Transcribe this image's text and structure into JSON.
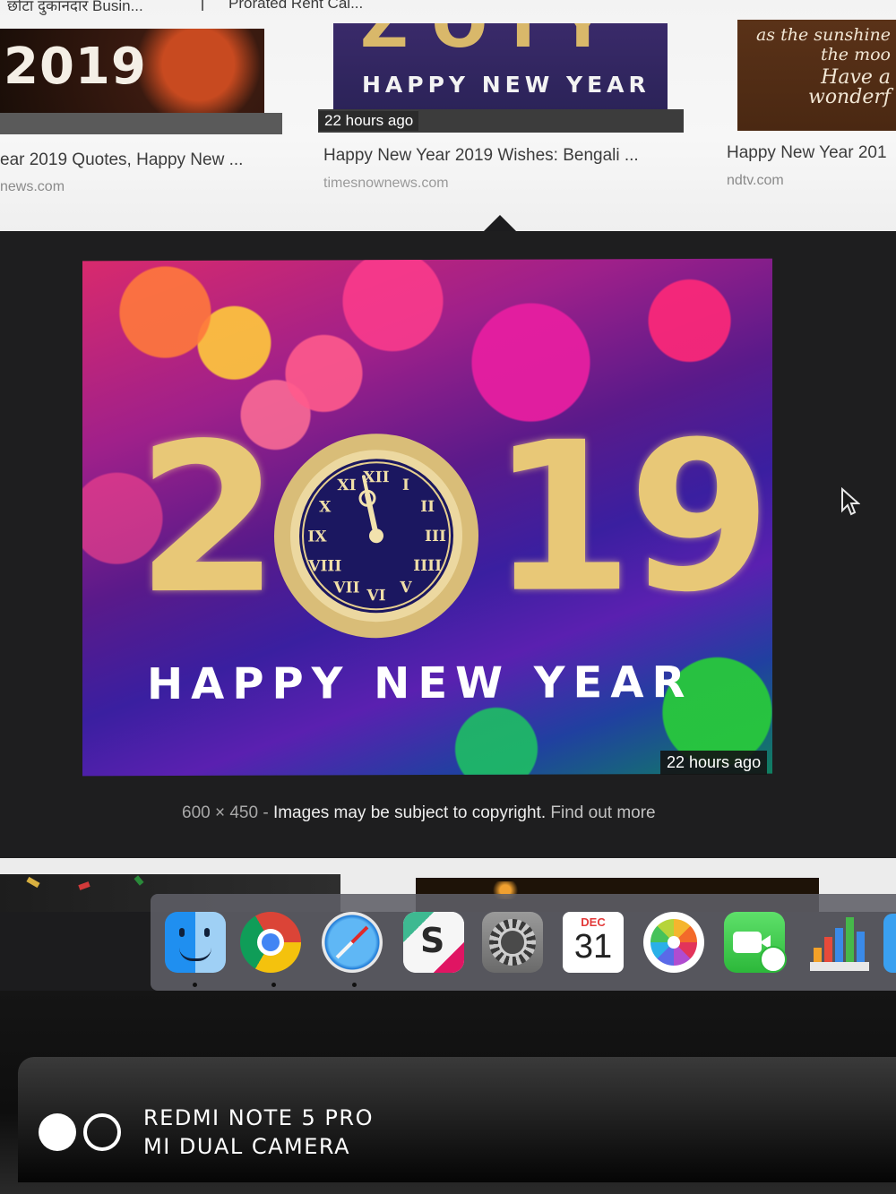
{
  "top_results": {
    "crumbs": [
      "छोटा दुकानदार Busin...",
      "Prorated Rent Cal..."
    ],
    "items": [
      {
        "caption": "ear 2019 Quotes, Happy New ...",
        "source": "news.com",
        "thumb_text": "2019"
      },
      {
        "caption": "Happy New Year 2019 Wishes: Bengali ...",
        "source": "timesnownews.com",
        "thumb_text": "HAPPY NEW YEAR",
        "badge": "22 hours ago"
      },
      {
        "caption": "Happy New Year 201",
        "source": "ndtv.com",
        "thumb_lines": [
          "as the sunshine",
          "the moo",
          "Have a wonderf"
        ]
      }
    ]
  },
  "preview": {
    "year_left": "2",
    "year_right": "19",
    "greeting": "HAPPY NEW YEAR",
    "badge": "22 hours ago",
    "dimensions": "600 × 450",
    "separator": "-",
    "copyright": "Images may be subject to copyright.",
    "find_out_more": "Find out more",
    "clock_numerals": [
      "XII",
      "I",
      "II",
      "III",
      "IIII",
      "V",
      "VI",
      "VII",
      "VIII",
      "IX",
      "X",
      "XI"
    ]
  },
  "dock": {
    "apps": [
      {
        "name": "Finder",
        "icon": "finder-icon",
        "running": true
      },
      {
        "name": "Chrome",
        "icon": "chrome-icon",
        "running": true
      },
      {
        "name": "Safari",
        "icon": "safari-icon",
        "running": true
      },
      {
        "name": "Slack",
        "icon": "slack-icon",
        "running": false
      },
      {
        "name": "System Preferences",
        "icon": "gear-icon",
        "running": false
      },
      {
        "name": "Calendar",
        "icon": "calendar-icon",
        "running": false,
        "month": "DEC",
        "day": "31"
      },
      {
        "name": "Photos",
        "icon": "photos-icon",
        "running": false
      },
      {
        "name": "FaceTime",
        "icon": "facetime-icon",
        "running": false
      },
      {
        "name": "Numbers",
        "icon": "numbers-chart-icon",
        "running": false
      }
    ]
  },
  "watermark": {
    "line1": "REDMI NOTE 5 PRO",
    "line2": "MI DUAL CAMERA"
  },
  "colors": {
    "gold": "#e8c877",
    "panel_bg": "#1e1e1f",
    "dock_bg": "#5f5f66"
  }
}
